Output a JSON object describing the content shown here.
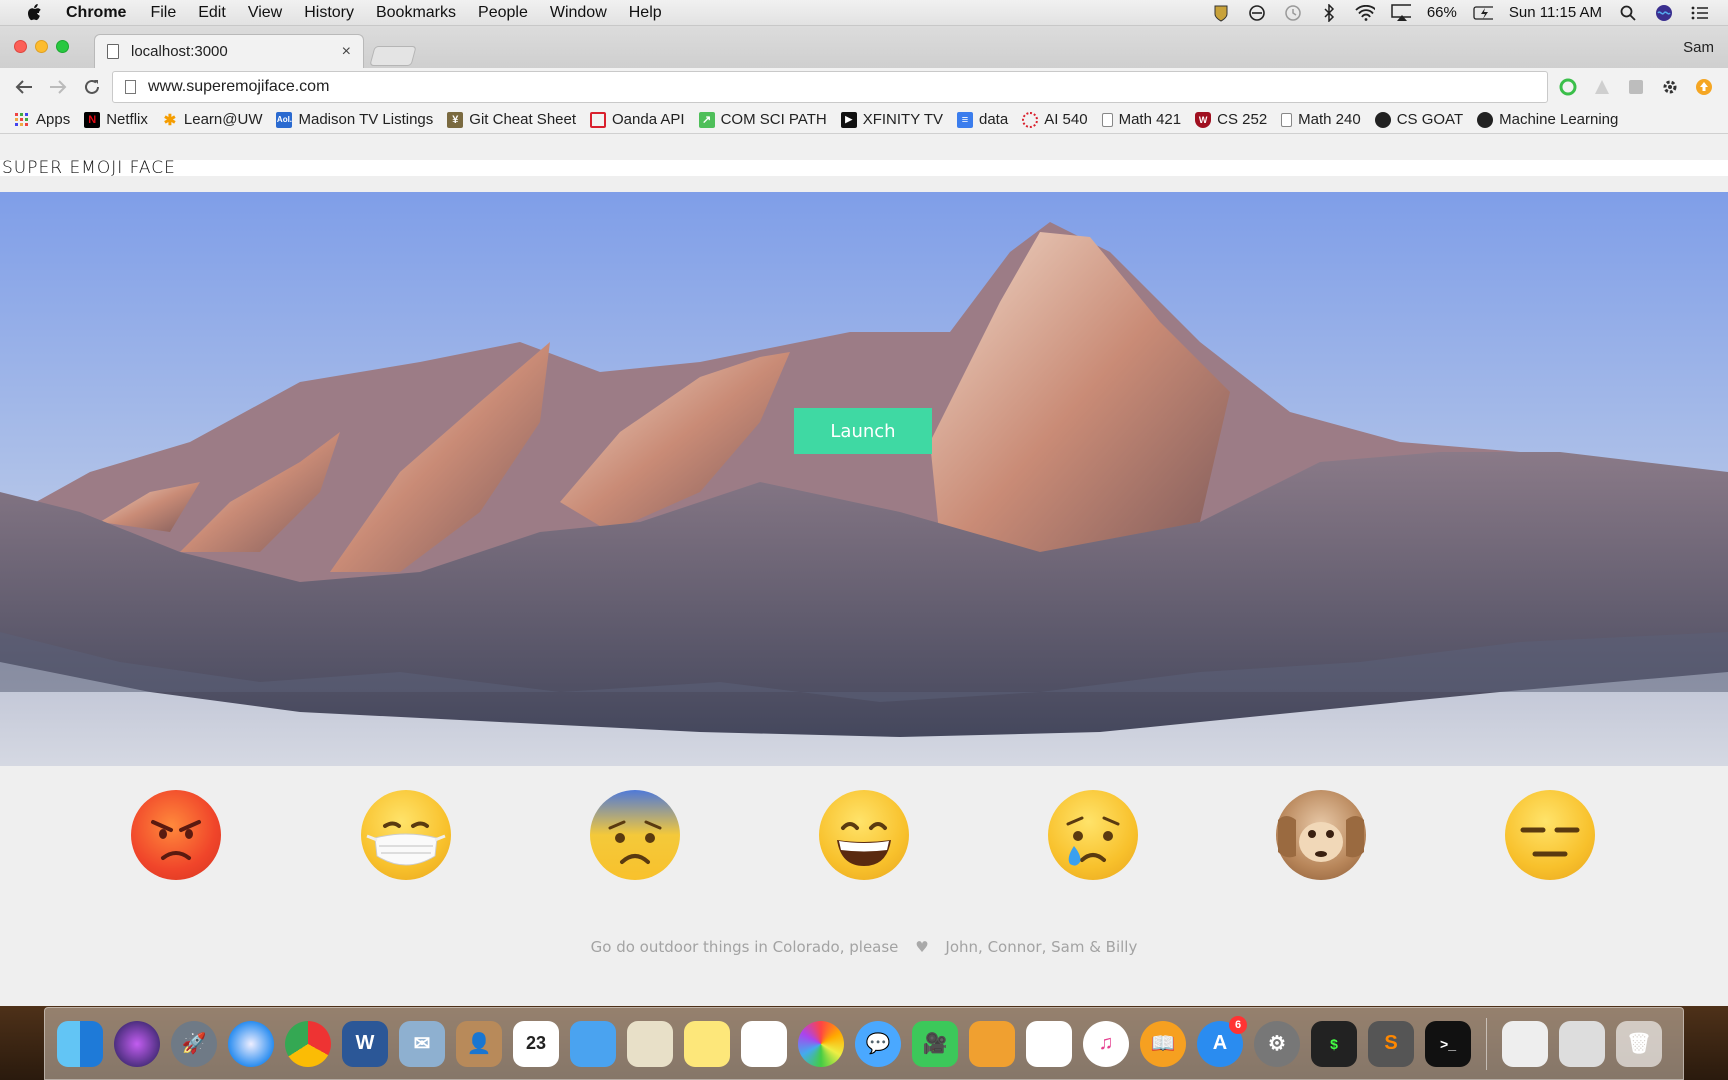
{
  "menubar": {
    "app_name": "Chrome",
    "menus": [
      "File",
      "Edit",
      "View",
      "History",
      "Bookmarks",
      "People",
      "Window",
      "Help"
    ],
    "battery": "66%",
    "clock": "Sun 11:15 AM"
  },
  "browser": {
    "tab_title": "localhost:3000",
    "tab_close": "×",
    "profile_name": "Sam",
    "url": "www.superemojiface.com",
    "bookmarks": [
      {
        "label": "Apps",
        "icon": "apps-grid-icon",
        "color": "#e54"
      },
      {
        "label": "Netflix",
        "icon": "netflix-icon",
        "color": "#e50914"
      },
      {
        "label": "Learn@UW",
        "icon": "learn-uw-icon",
        "color": "#f59d00"
      },
      {
        "label": "Madison TV Listings",
        "icon": "aol-icon",
        "color": "#2a6ad0"
      },
      {
        "label": "Git Cheat Sheet",
        "icon": "git-icon",
        "color": "#7a6a40"
      },
      {
        "label": "Oanda API",
        "icon": "oanda-icon",
        "color": "#d9202d"
      },
      {
        "label": "COM SCI PATH",
        "icon": "comsci-icon",
        "color": "#4fbf5a"
      },
      {
        "label": "XFINITY TV",
        "icon": "xfinity-icon",
        "color": "#111"
      },
      {
        "label": "data",
        "icon": "google-docs-icon",
        "color": "#3b7ded"
      },
      {
        "label": "AI 540",
        "icon": "ai-icon",
        "color": "#d9202d"
      },
      {
        "label": "Math 421",
        "icon": "page-icon",
        "color": "#888"
      },
      {
        "label": "CS 252",
        "icon": "uw-crest-icon",
        "color": "#a01020"
      },
      {
        "label": "Math 240",
        "icon": "page-icon",
        "color": "#888"
      },
      {
        "label": "CS GOAT",
        "icon": "github-icon",
        "color": "#222"
      },
      {
        "label": "Machine Learning",
        "icon": "github-icon",
        "color": "#222"
      }
    ]
  },
  "page": {
    "site_title": "SUPER EMOJI FACE",
    "launch_label": "Launch",
    "emojis": [
      "angry-face",
      "face-with-medical-mask",
      "anxious-face-with-sweat",
      "grinning-face",
      "crying-face",
      "hear-no-evil-monkey",
      "expressionless-face"
    ],
    "footer_left": "Go do outdoor things in Colorado, please",
    "footer_heart": "♥",
    "footer_right": "John, Connor, Sam & Billy",
    "accent_color": "#3fd9a3"
  },
  "dock": {
    "appstore_badge": "6"
  }
}
